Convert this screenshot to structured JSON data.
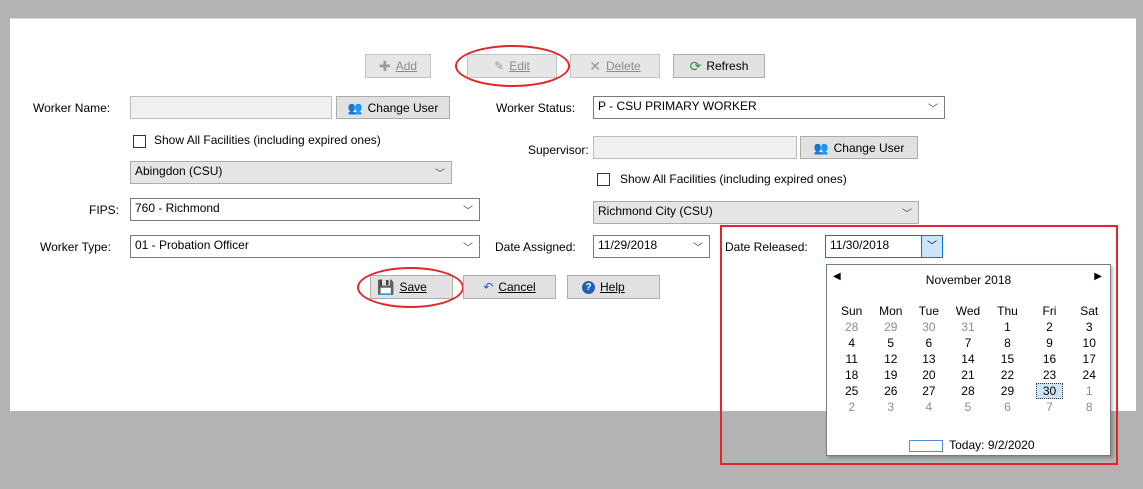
{
  "toolbar": {
    "add": "Add",
    "edit": "Edit",
    "delete": "Delete",
    "refresh": "Refresh"
  },
  "worker": {
    "name_label": "Worker Name:",
    "name_value": "",
    "change_user": "Change User",
    "show_all_facilities": "Show All Facilities (including expired ones)",
    "facility": "Abingdon (CSU)",
    "fips_label": "FIPS:",
    "fips": "760 - Richmond",
    "type_label": "Worker Type:",
    "type": "01 - Probation Officer"
  },
  "right": {
    "status_label": "Worker Status:",
    "status": "P - CSU PRIMARY WORKER",
    "supervisor_label": "Supervisor:",
    "supervisor_value": "",
    "change_user": "Change User",
    "show_all_facilities": "Show All Facilities (including expired ones)",
    "facility": "Richmond City (CSU)",
    "date_assigned_label": "Date Assigned:",
    "date_assigned": "11/29/2018",
    "date_released_label": "Date Released:",
    "date_released": "11/30/2018"
  },
  "actions": {
    "save": "Save",
    "cancel": "Cancel",
    "help": "Help"
  },
  "calendar": {
    "month_title": "November 2018",
    "days": [
      "Sun",
      "Mon",
      "Tue",
      "Wed",
      "Thu",
      "Fri",
      "Sat"
    ],
    "weeks": [
      [
        "28",
        "29",
        "30",
        "31",
        "1",
        "2",
        "3"
      ],
      [
        "4",
        "5",
        "6",
        "7",
        "8",
        "9",
        "10"
      ],
      [
        "11",
        "12",
        "13",
        "14",
        "15",
        "16",
        "17"
      ],
      [
        "18",
        "19",
        "20",
        "21",
        "22",
        "23",
        "24"
      ],
      [
        "25",
        "26",
        "27",
        "28",
        "29",
        "30",
        "1"
      ],
      [
        "2",
        "3",
        "4",
        "5",
        "6",
        "7",
        "8"
      ]
    ],
    "other_month": [
      [
        true,
        true,
        true,
        true,
        false,
        false,
        false
      ],
      [
        false,
        false,
        false,
        false,
        false,
        false,
        false
      ],
      [
        false,
        false,
        false,
        false,
        false,
        false,
        false
      ],
      [
        false,
        false,
        false,
        false,
        false,
        false,
        false
      ],
      [
        false,
        false,
        false,
        false,
        false,
        false,
        true
      ],
      [
        true,
        true,
        true,
        true,
        true,
        true,
        true
      ]
    ],
    "selected_day": "30",
    "today": "Today: 9/2/2020"
  },
  "colors": {
    "highlight_red": "#e0262a",
    "background": "#b3b3b3"
  }
}
